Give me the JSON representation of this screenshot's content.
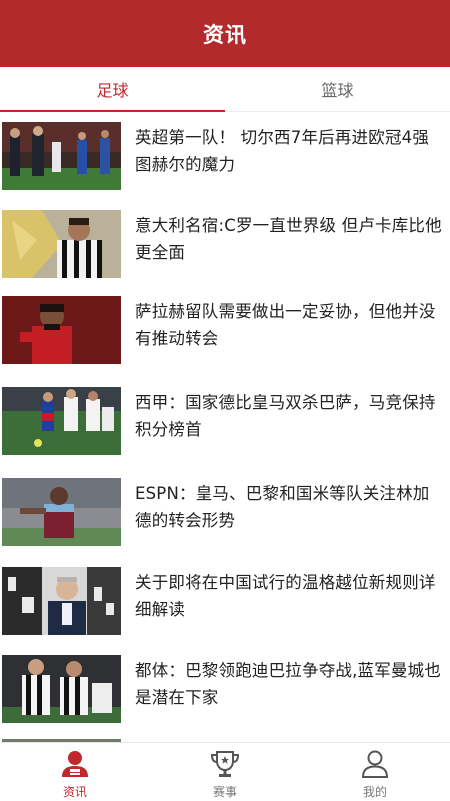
{
  "header": {
    "title": "资讯"
  },
  "tabs": [
    {
      "label": "足球",
      "active": true
    },
    {
      "label": "篮球",
      "active": false
    }
  ],
  "news": [
    {
      "title": "英超第一队！ 切尔西7年后再进欧冠4强 图赫尔的魔力"
    },
    {
      "title": "意大利名宿:C罗一直世界级 但卢卡库比他更全面"
    },
    {
      "title": "萨拉赫留队需要做出一定妥协，但他并没有推动转会"
    },
    {
      "title": "西甲：国家德比皇马双杀巴萨，马竞保持积分榜首"
    },
    {
      "title": "ESPN：皇马、巴黎和国米等队关注林加德的转会形势"
    },
    {
      "title": "关于即将在中国试行的温格越位新规则详细解读"
    },
    {
      "title": "都体：巴黎领跑迪巴拉争夺战,蓝军曼城也是潜在下家"
    }
  ],
  "bottom_nav": [
    {
      "label": "资讯",
      "icon": "news-icon",
      "active": true
    },
    {
      "label": "赛事",
      "icon": "trophy-icon",
      "active": false
    },
    {
      "label": "我的",
      "icon": "user-icon",
      "active": false
    }
  ],
  "colors": {
    "brand": "#b32a2c",
    "accent": "#c0282c"
  }
}
